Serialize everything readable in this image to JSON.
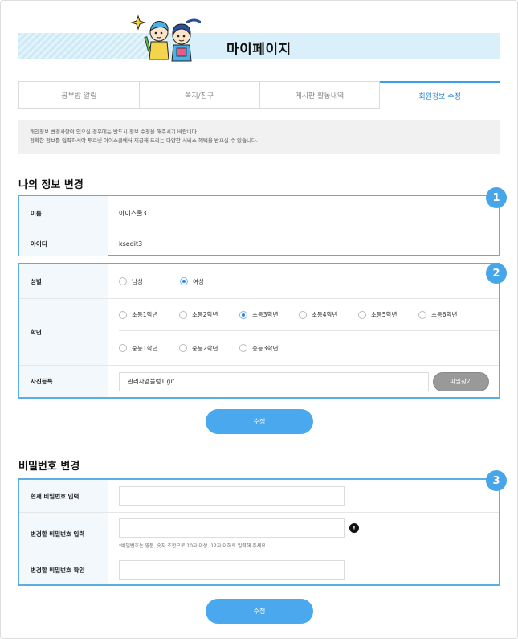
{
  "header": {
    "title": "마이페이지"
  },
  "tabs": [
    {
      "label": "공부방 알림",
      "active": false
    },
    {
      "label": "쪽지/친구",
      "active": false
    },
    {
      "label": "게시판 활동내역",
      "active": false
    },
    {
      "label": "회원정보 수정",
      "active": true
    }
  ],
  "notice": {
    "line1": "개인정보 변경사항이 있으실 경우에는 반드시 정보 수정을 해주시기 바랍니다.",
    "line2": "정확한 정보를 입력하셔야 투르넷 아이스쿨에서 제공해 드리는 다양한 서비스 혜택을 받으실 수 있습니다."
  },
  "info_section": {
    "title": "나의 정보 변경",
    "badge1": "1",
    "badge2": "2",
    "name_label": "이름",
    "name_value": "아이스쿨3",
    "id_label": "아이디",
    "id_value": "ksedit3",
    "gender_label": "성별",
    "gender_options": [
      "남성",
      "여성"
    ],
    "gender_selected": "여성",
    "grade_label": "학년",
    "grade_options_row1": [
      "초등1학년",
      "초등2학년",
      "초등3학년",
      "초등4학년",
      "초등5학년",
      "초등6학년"
    ],
    "grade_options_row2": [
      "중등1학년",
      "중등2학년",
      "중등3학년"
    ],
    "grade_selected": "초등3학년",
    "photo_label": "사진등록",
    "photo_value": "관리자엠블럼1.gif",
    "photo_button": "파일찾기",
    "submit": "수정"
  },
  "password_section": {
    "title": "비밀번호 변경",
    "badge3": "3",
    "current_label": "현재 비밀번호 입력",
    "new_label": "변경할 비밀번호 입력",
    "new_hint": "*비밀번호는 영문, 숫자 조합으로 10자 이상, 12자 이하로 입력해 주세요.",
    "confirm_label": "변경할 비밀번호 확인",
    "submit": "수정"
  },
  "colors": {
    "accent": "#4aa8ee",
    "border": "#5aaee4",
    "tab_active": "#2a86d8"
  }
}
